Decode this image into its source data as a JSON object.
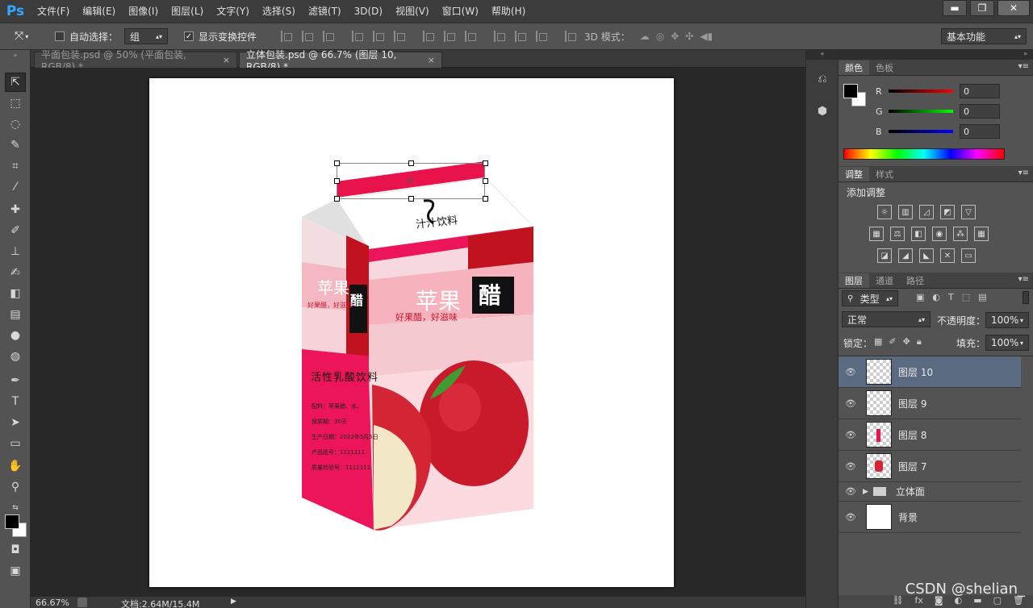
{
  "app": {
    "logo": "Ps"
  },
  "menu": [
    "文件(F)",
    "编辑(E)",
    "图像(I)",
    "图层(L)",
    "文字(Y)",
    "选择(S)",
    "滤镜(T)",
    "3D(D)",
    "视图(V)",
    "窗口(W)",
    "帮助(H)"
  ],
  "window_controls": {
    "minimize": "▬",
    "restore": "❐",
    "close": "✕"
  },
  "options": {
    "auto_select_label": "自动选择：",
    "auto_select_value": "组",
    "show_transform_label": "显示变换控件",
    "mode_3d_label": "3D 模式：",
    "workspace": "基本功能"
  },
  "tabs": [
    {
      "title": "平面包装.psd @ 50% (平面包装, RGB/8) *",
      "close": "×"
    },
    {
      "title": "立体包装.psd @ 66.7% (图层 10, RGB/8) *",
      "close": "×"
    }
  ],
  "artwork": {
    "top_label": "汁汁饮料",
    "product": "苹果",
    "vinegar": "醋",
    "slogan_front": "好果醋，好滋味",
    "slogan_side": "好果醋，好滋味",
    "side_title": "活性乳酸饮料",
    "side_lines": [
      "配料：苹果醋、水、",
      "保质期：30天",
      "生产日期：2022年5月5日",
      "产品批号：1111111",
      "质量检验号：1111111"
    ]
  },
  "status": {
    "zoom": "66.67%",
    "doc": "文档:2.64M/15.4M"
  },
  "color_panel": {
    "tabs": [
      "颜色",
      "色板"
    ],
    "channels": [
      {
        "name": "R",
        "value": "0",
        "color": "#ff0000"
      },
      {
        "name": "G",
        "value": "0",
        "color": "#00ff00"
      },
      {
        "name": "B",
        "value": "0",
        "color": "#0000ff"
      }
    ]
  },
  "adjust_panel": {
    "tabs": [
      "调整",
      "样式"
    ],
    "title": "添加调整"
  },
  "layers_panel": {
    "tabs": [
      "图层",
      "通道",
      "路径"
    ],
    "filter": "类型",
    "blend_mode": "正常",
    "opacity_label": "不透明度：",
    "opacity": "100%",
    "lock_label": "锁定：",
    "fill_label": "填充：",
    "fill": "100%",
    "layers": [
      {
        "name": "图层 10"
      },
      {
        "name": "图层 9"
      },
      {
        "name": "图层 8"
      },
      {
        "name": "图层 7"
      },
      {
        "name": "立体面"
      },
      {
        "name": "背景"
      }
    ]
  },
  "watermark": "CSDN @shelian_"
}
